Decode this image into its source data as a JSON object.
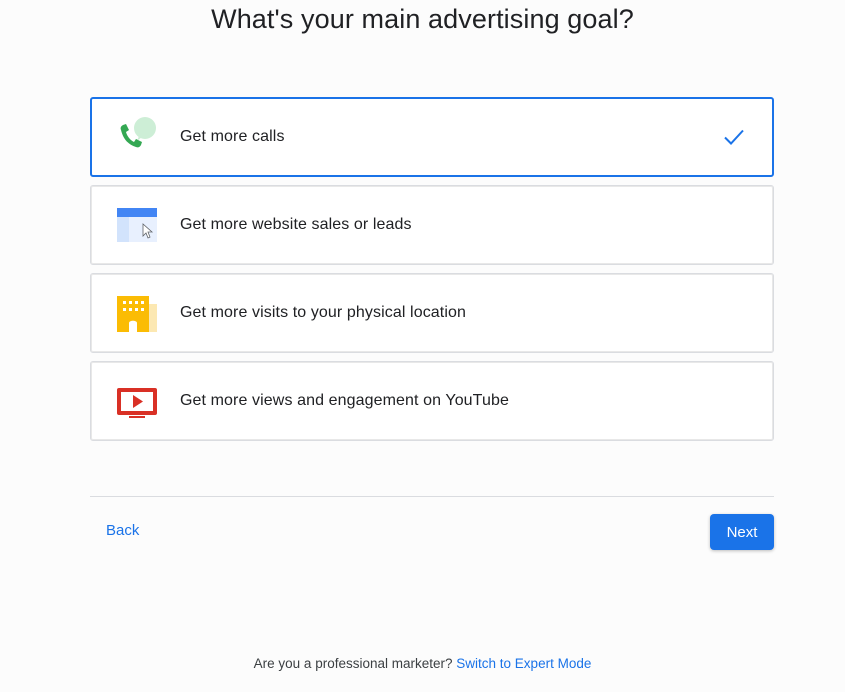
{
  "page": {
    "title": "What's your main advertising goal?"
  },
  "options": [
    {
      "label": "Get more calls",
      "icon": "phone-call-icon",
      "selected": true
    },
    {
      "label": "Get more website sales or leads",
      "icon": "website-cursor-icon",
      "selected": false
    },
    {
      "label": "Get more visits to your physical location",
      "icon": "storefront-icon",
      "selected": false
    },
    {
      "label": "Get more views and engagement on YouTube",
      "icon": "video-play-icon",
      "selected": false
    }
  ],
  "nav": {
    "back_label": "Back",
    "next_label": "Next"
  },
  "footer": {
    "prompt": "Are you a professional marketer?",
    "link": "Switch to Expert Mode"
  },
  "colors": {
    "accent": "#1a73e8",
    "phone_green": "#34a853",
    "building_yellow": "#fbbc04",
    "video_red": "#d93025"
  }
}
